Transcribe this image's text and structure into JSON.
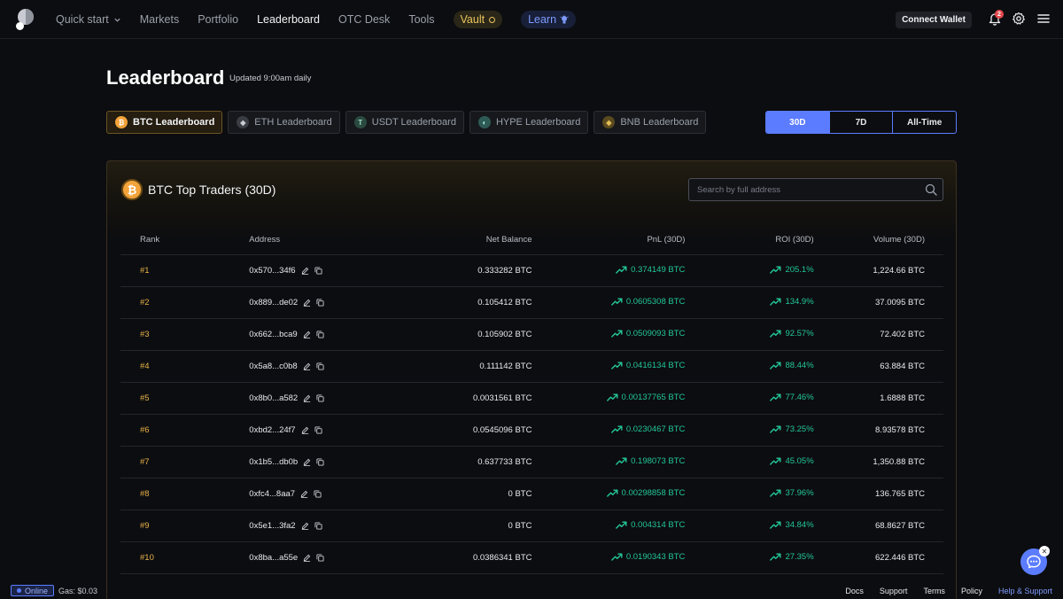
{
  "nav": {
    "items": [
      {
        "label": "Quick start",
        "has_chevron": true,
        "active": false
      },
      {
        "label": "Markets",
        "active": false
      },
      {
        "label": "Portfolio",
        "active": false
      },
      {
        "label": "Leaderboard",
        "active": true
      },
      {
        "label": "OTC Desk",
        "active": false
      },
      {
        "label": "Tools",
        "active": false
      }
    ],
    "vault_label": "Vault",
    "learn_label": "Learn",
    "connect_label": "Connect Wallet",
    "notification_count": "2"
  },
  "page": {
    "title": "Leaderboard",
    "subtitle": "Updated 9:00am daily"
  },
  "coin_tabs": [
    {
      "label": "BTC Leaderboard",
      "active": true,
      "icon": "bitcoin-icon",
      "color": "#f2a33a"
    },
    {
      "label": "ETH Leaderboard",
      "active": false,
      "icon": "ethereum-icon",
      "color": "#3a3d44"
    },
    {
      "label": "USDT Leaderboard",
      "active": false,
      "icon": "tether-icon",
      "color": "#2a4a40"
    },
    {
      "label": "HYPE Leaderboard",
      "active": false,
      "icon": "hype-icon",
      "color": "#2e5a55"
    },
    {
      "label": "BNB Leaderboard",
      "active": false,
      "icon": "bnb-icon",
      "color": "#5a4a1e"
    }
  ],
  "range_tabs": [
    {
      "label": "30D",
      "active": true
    },
    {
      "label": "7D",
      "active": false
    },
    {
      "label": "All-Time",
      "active": false
    }
  ],
  "card": {
    "title": "BTC Top Traders (30D)",
    "search_placeholder": "Search by full address"
  },
  "table": {
    "headers": [
      "Rank",
      "Address",
      "Net Balance",
      "PnL (30D)",
      "ROI (30D)",
      "Volume (30D)"
    ],
    "rows": [
      {
        "rank": "#1",
        "address": "0x570...34f6",
        "net": "0.333282 BTC",
        "pnl": "0.374149 BTC",
        "roi": "205.1%",
        "volume": "1,224.66 BTC"
      },
      {
        "rank": "#2",
        "address": "0x889...de02",
        "net": "0.105412 BTC",
        "pnl": "0.0605308 BTC",
        "roi": "134.9%",
        "volume": "37.0095 BTC"
      },
      {
        "rank": "#3",
        "address": "0x662...bca9",
        "net": "0.105902 BTC",
        "pnl": "0.0509093 BTC",
        "roi": "92.57%",
        "volume": "72.402 BTC"
      },
      {
        "rank": "#4",
        "address": "0x5a8...c0b8",
        "net": "0.111142 BTC",
        "pnl": "0.0416134 BTC",
        "roi": "88.44%",
        "volume": "63.884 BTC"
      },
      {
        "rank": "#5",
        "address": "0x8b0...a582",
        "net": "0.0031561 BTC",
        "pnl": "0.00137765 BTC",
        "roi": "77.46%",
        "volume": "1.6888 BTC"
      },
      {
        "rank": "#6",
        "address": "0xbd2...24f7",
        "net": "0.0545096 BTC",
        "pnl": "0.0230467 BTC",
        "roi": "73.25%",
        "volume": "8.93578 BTC"
      },
      {
        "rank": "#7",
        "address": "0x1b5...db0b",
        "net": "0.637733 BTC",
        "pnl": "0.198073 BTC",
        "roi": "45.05%",
        "volume": "1,350.88 BTC"
      },
      {
        "rank": "#8",
        "address": "0xfc4...8aa7",
        "net": "0 BTC",
        "pnl": "0.00298858 BTC",
        "roi": "37.96%",
        "volume": "136.765 BTC"
      },
      {
        "rank": "#9",
        "address": "0x5e1...3fa2",
        "net": "0 BTC",
        "pnl": "0.004314 BTC",
        "roi": "34.84%",
        "volume": "68.8627 BTC"
      },
      {
        "rank": "#10",
        "address": "0x8ba...a55e",
        "net": "0.0386341 BTC",
        "pnl": "0.0190343 BTC",
        "roi": "27.35%",
        "volume": "622.446 BTC"
      }
    ]
  },
  "footer": {
    "status": "Online",
    "gas": "Gas: $0.03",
    "links": [
      {
        "label": "Docs",
        "accent": false
      },
      {
        "label": "Support",
        "accent": false
      },
      {
        "label": "Terms",
        "accent": false
      },
      {
        "label": "Policy",
        "accent": false
      },
      {
        "label": "Help & Support",
        "accent": true
      }
    ]
  },
  "colors": {
    "accent": "#5b7cff",
    "gain": "#22c79a",
    "rank": "#e8b24a",
    "btc": "#f2a33a"
  }
}
